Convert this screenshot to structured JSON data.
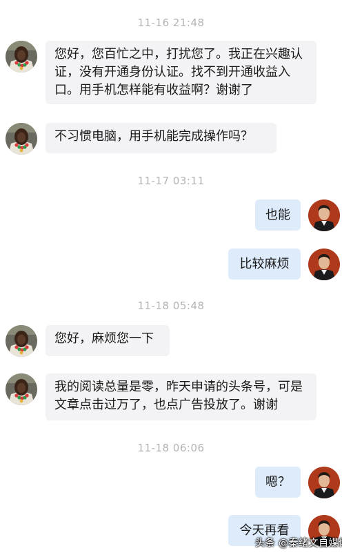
{
  "conversation": {
    "timestamps": [
      "11-16 21:48",
      "11-17 03:11",
      "11-18 05:48",
      "11-18 06:06"
    ],
    "messages": [
      {
        "side": "left",
        "text": "您好，您百忙之中，打扰您了。我正在兴趣认证，没有开通身份认证。找不到开通收益入口。用手机怎样能有收益啊？谢谢了"
      },
      {
        "side": "left",
        "text": "不习惯电脑，用手机能完成操作吗？"
      },
      {
        "side": "right",
        "text": "也能"
      },
      {
        "side": "right",
        "text": "比较麻烦"
      },
      {
        "side": "left",
        "text": "您好，麻烦您一下"
      },
      {
        "side": "left",
        "text": "我的阅读总量是零，昨天申请的头条号，可是文章点击过万了，也点广告投放了。谢谢"
      },
      {
        "side": "right",
        "text": "嗯？"
      },
      {
        "side": "right",
        "text": "今天再看"
      }
    ]
  },
  "watermark": {
    "text": "头条 @秦绪文自媒体"
  },
  "colors": {
    "incoming_bubble": "#f3f3f5",
    "outgoing_bubble": "#ddebfb",
    "timestamp_text": "#b3b3b3",
    "message_text": "#1a1a1a"
  },
  "icons": {
    "incoming_avatar": "user-avatar-icon",
    "outgoing_avatar": "user-avatar-icon"
  }
}
